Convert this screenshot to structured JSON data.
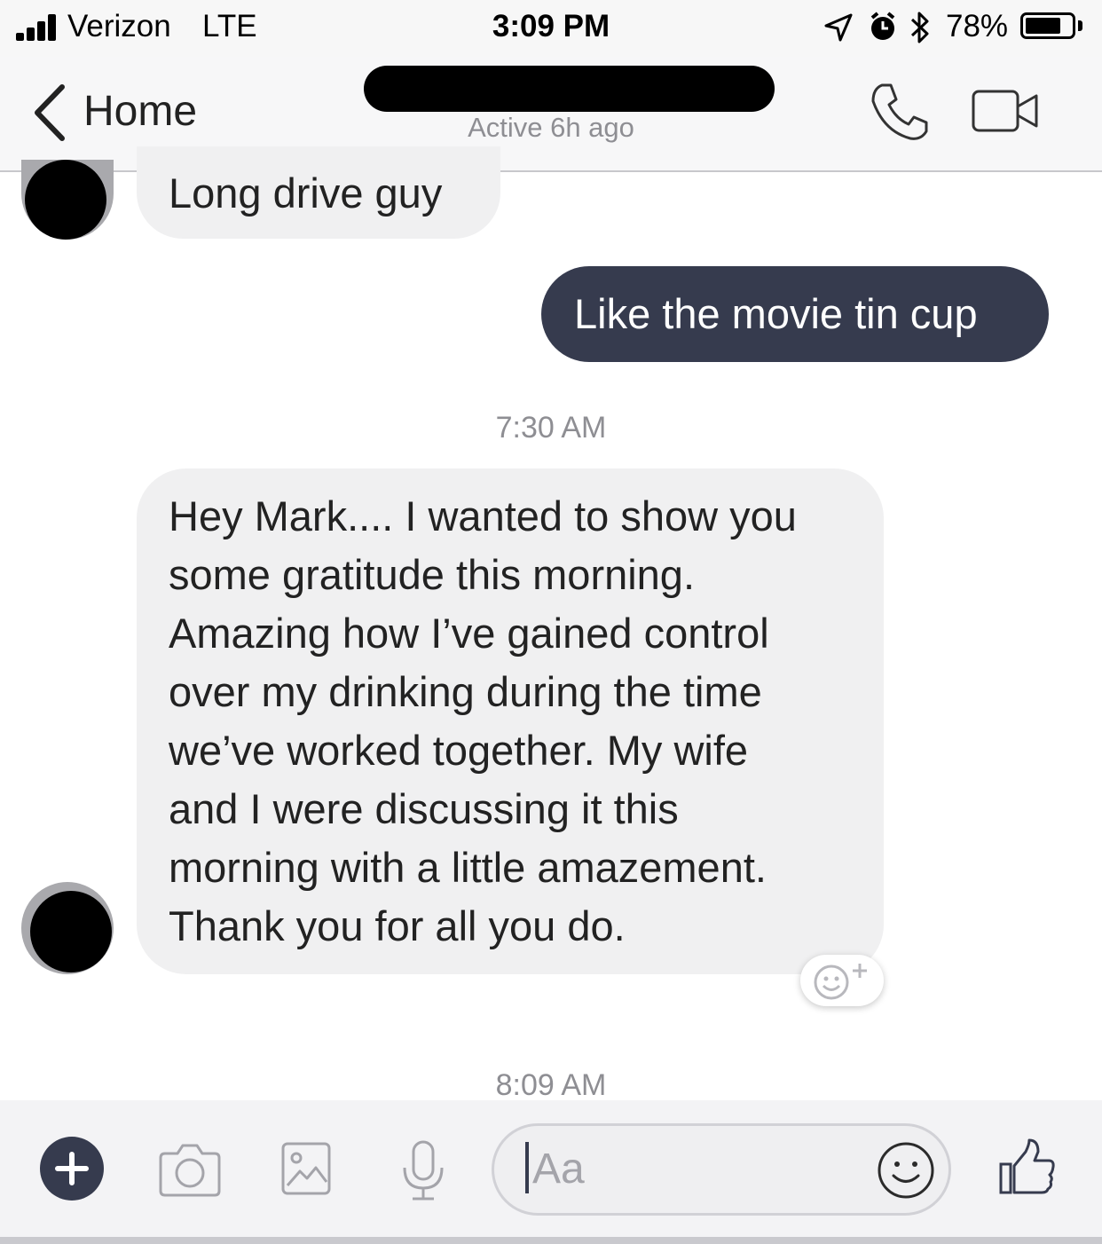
{
  "status_bar": {
    "carrier": "Verizon",
    "network": "LTE",
    "time": "3:09 PM",
    "battery_percent": "78%",
    "battery_level": 0.78,
    "icons": [
      "signal-icon",
      "location-icon",
      "alarm-icon",
      "bluetooth-icon",
      "battery-icon"
    ]
  },
  "nav": {
    "back_label": "Home",
    "contact_status": "Active 6h ago",
    "icons": [
      "chevron-left-icon",
      "phone-icon",
      "video-camera-icon"
    ]
  },
  "messages": [
    {
      "direction": "incoming",
      "text": "Long drive guy"
    },
    {
      "direction": "outgoing",
      "text": "Like the movie tin cup"
    },
    {
      "type": "timestamp",
      "text": "7:30 AM"
    },
    {
      "direction": "incoming",
      "lines": [
        "Hey Mark.... I wanted to show you",
        "some gratitude this morning.",
        "Amazing how I’ve gained control",
        "over my drinking during the time",
        "we’ve worked together.  My wife",
        "and I were discussing it this",
        "morning with a little amazement.",
        "Thank you for all you do."
      ]
    },
    {
      "type": "timestamp",
      "text": "8:09 AM"
    }
  ],
  "composer": {
    "placeholder": "Aa",
    "icons": [
      "plus-icon",
      "camera-icon",
      "image-icon",
      "microphone-icon",
      "emoji-icon",
      "thumbs-up-icon"
    ]
  },
  "colors": {
    "outgoing_bubble": "#363b4e",
    "incoming_bubble": "#f0f0f1",
    "timestamp_text": "#8e8e93"
  }
}
